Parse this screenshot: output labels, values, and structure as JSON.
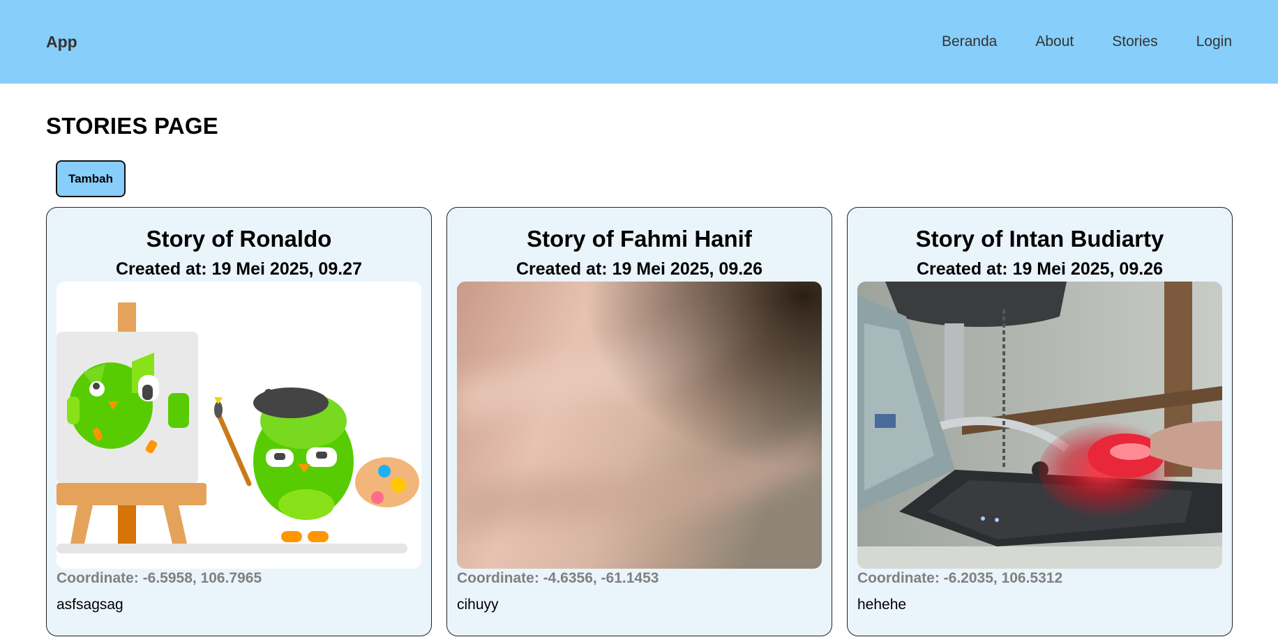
{
  "header": {
    "brand": "App",
    "nav": [
      "Beranda",
      "About",
      "Stories",
      "Login"
    ]
  },
  "page": {
    "title": "STORIES PAGE",
    "add_button": "Tambah"
  },
  "stories": [
    {
      "title": "Story of Ronaldo",
      "created": "Created at: 19 Mei 2025, 09.27",
      "image": "owl-painting-illustration",
      "coordinate": "Coordinate: -6.5958, 106.7965",
      "description": "asfsagsag"
    },
    {
      "title": "Story of Fahmi Hanif",
      "created": "Created at: 19 Mei 2025, 09.26",
      "image": "blurry-skin-closeup-photo",
      "coordinate": "Coordinate: -4.6356, -61.1453",
      "description": "cihuyy"
    },
    {
      "title": "Story of Intan Budiarty",
      "created": "Created at: 19 Mei 2025, 09.26",
      "image": "laptop-and-mouse-photo",
      "coordinate": "Coordinate: -6.2035, 106.5312",
      "description": "hehehe"
    }
  ],
  "colors": {
    "header_bg": "#87cefa",
    "card_bg": "#eaf4fb",
    "coordinate_text": "#808080"
  }
}
